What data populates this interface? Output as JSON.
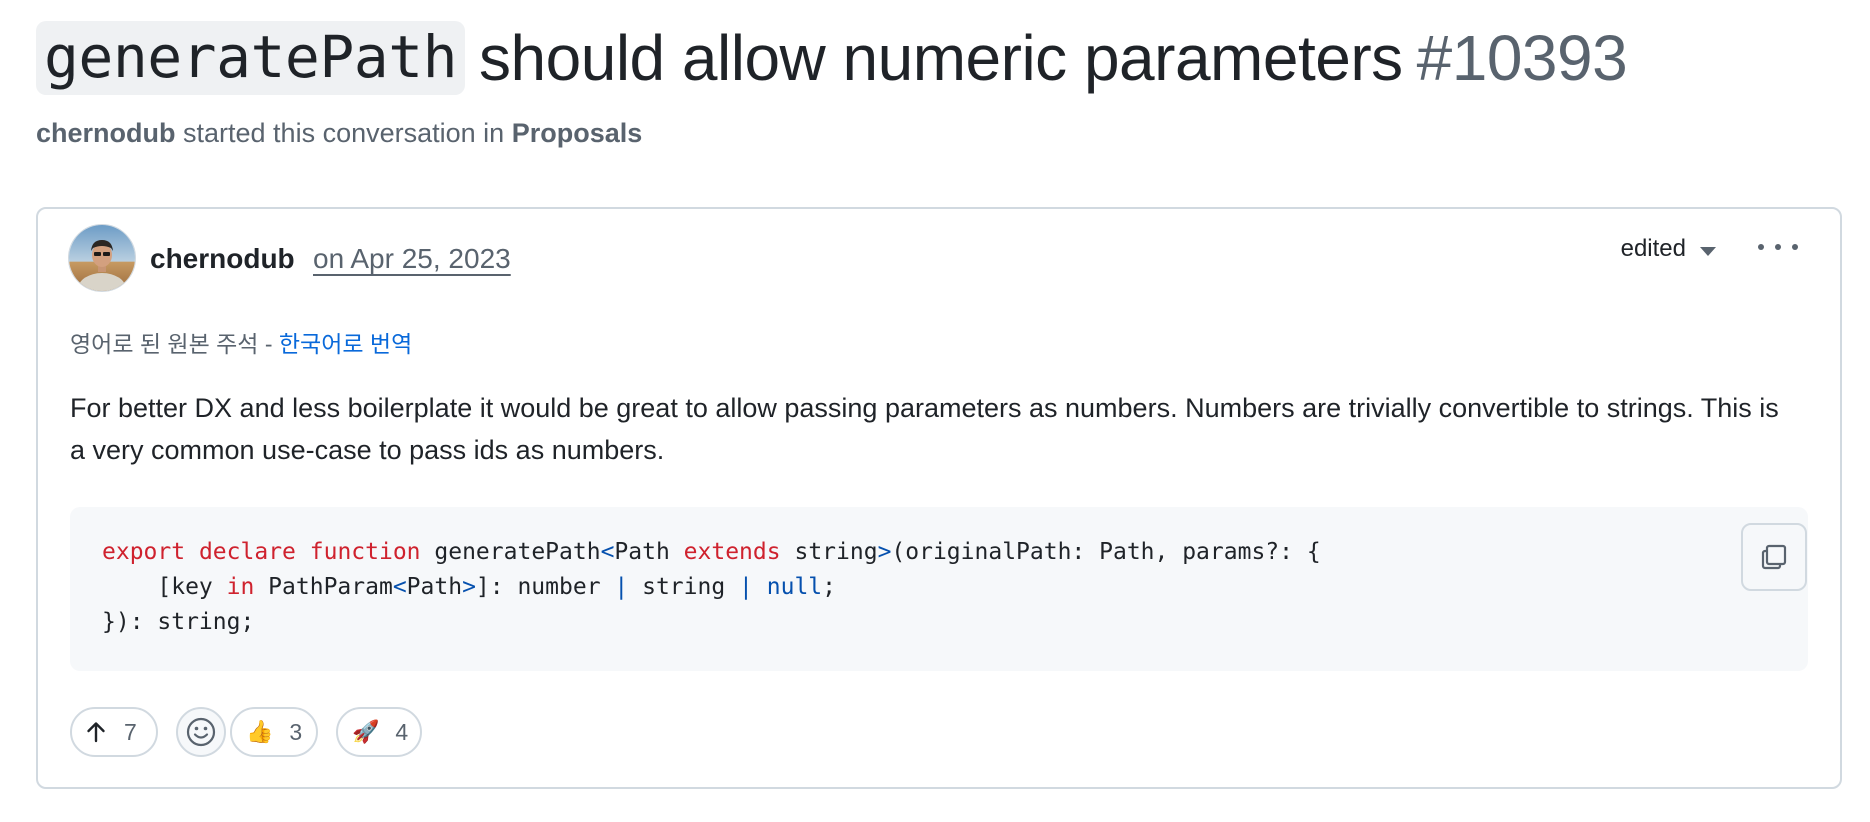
{
  "discussion": {
    "title_code": "generatePath",
    "title_text": "should allow numeric parameters",
    "number": "#10393",
    "starter": "chernodub",
    "started_text": "started this conversation in",
    "category": "Proposals"
  },
  "post": {
    "author": "chernodub",
    "date": "on Apr 25, 2023",
    "edited_label": "edited",
    "translate_prefix": "영어로 된 원본 주석 - ",
    "translate_link": "한국어로 번역",
    "body": "For better DX and less boilerplate it would be great to allow passing parameters as numbers. Numbers are trivially convertible to strings. This is a very common use-case to pass ids as numbers.",
    "code": {
      "line1": {
        "kw1": "export",
        "kw2": "declare",
        "kw3": "function",
        "fn": "generatePath",
        "lt": "<",
        "type": "Path",
        "kw4": "extends",
        "str": "string",
        "gt": ">",
        "rest": "(originalPath: Path, params?: {"
      },
      "line2": {
        "indent_open": "    [key ",
        "kw_in": "in",
        "pp": " PathParam",
        "lt": "<",
        "type": "Path",
        "gt": ">",
        "after": "]: number ",
        "pipe1": "|",
        "mid": " string ",
        "pipe2": "|",
        "sp": " ",
        "nul": "null",
        "semi": ";"
      },
      "line3": "}): string;"
    },
    "reactions": {
      "upvotes": "7",
      "thumbs_up": "3",
      "rocket": "4"
    }
  },
  "icons": {
    "upvote": "arrow-up-icon",
    "smiley": "smiley-icon",
    "copy": "copy-icon",
    "more": "kebab-horizontal-icon",
    "caret": "triangle-down-icon"
  },
  "colors": {
    "text": "#1f2328",
    "muted": "#59636e",
    "link": "#0969da",
    "keyword": "#cf222e",
    "entity": "#0550ae",
    "border": "#d1d9e0",
    "code_bg": "#f6f8fa"
  }
}
